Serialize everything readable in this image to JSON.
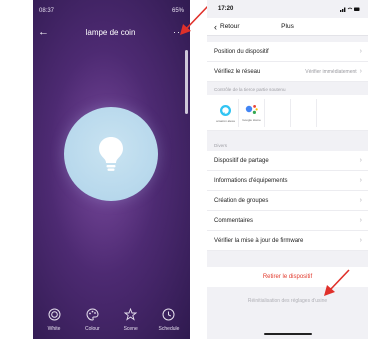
{
  "left_phone": {
    "status": {
      "time": "08:37",
      "right": "65%"
    },
    "title": "lampe de coin",
    "bottom_tabs": [
      {
        "label": "White",
        "icon": "white-mode-icon"
      },
      {
        "label": "Colour",
        "icon": "palette-icon"
      },
      {
        "label": "Scene",
        "icon": "star-icon"
      },
      {
        "label": "Schedule",
        "icon": "clock-icon"
      }
    ]
  },
  "right_phone": {
    "status": {
      "time": "17:20"
    },
    "nav": {
      "back_label": "Retour",
      "title": "Plus"
    },
    "rows_top": [
      {
        "label": "Position du dispositif",
        "value": ""
      },
      {
        "label": "Vérifiez le réseau",
        "value": "Vérifier immédiatement"
      }
    ],
    "assistants_header": "Contrôle de la tierce partie soutenu",
    "assistants": [
      {
        "name": "amazon alexa"
      },
      {
        "name": "Google Home"
      }
    ],
    "divers_header": "Divers",
    "rows_divers": [
      {
        "label": "Dispositif de partage"
      },
      {
        "label": "Informations d'équipements"
      },
      {
        "label": "Création de groupes"
      },
      {
        "label": "Commentaires"
      },
      {
        "label": "Vérifier la mise à jour de firmware"
      }
    ],
    "remove_label": "Retirer le dispositif",
    "reset_label": "Réinitialisation des réglages d'usine"
  },
  "colors": {
    "annotation_red": "#e0302a",
    "remove_red": "#e23b2e"
  }
}
